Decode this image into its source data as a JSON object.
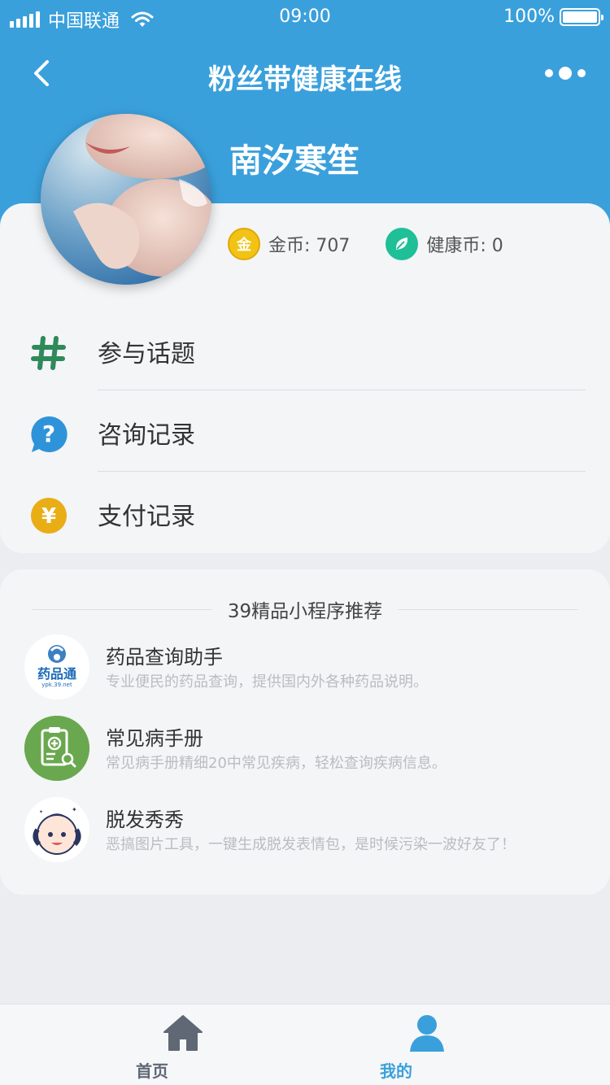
{
  "status_bar": {
    "carrier": "中国联通",
    "time": "09:00",
    "battery": "100%"
  },
  "nav": {
    "title": "粉丝带健康在线"
  },
  "profile": {
    "username": "南汐寒笙",
    "gold_coin_label": "金币: 707",
    "health_coin_label": "健康币: 0"
  },
  "menu": [
    {
      "label": "参与话题",
      "icon": "hash-icon"
    },
    {
      "label": "咨询记录",
      "icon": "question-bubble-icon"
    },
    {
      "label": "支付记录",
      "icon": "yuan-icon"
    }
  ],
  "recommend": {
    "title": "39精品小程序推荐",
    "apps": [
      {
        "name": "药品查询助手",
        "desc": "专业便民的药品查询，提供国内外各种药品说明。",
        "logo_text": "药品通",
        "logo_sub": "ypk.39.net"
      },
      {
        "name": "常见病手册",
        "desc": "常见病手册精细20中常见疾病，轻松查询疾病信息。"
      },
      {
        "name": "脱发秀秀",
        "desc": "恶搞图片工具，一键生成脱发表情包，是时候污染一波好友了！"
      }
    ]
  },
  "tabbar": {
    "home": "首页",
    "mine": "我的"
  },
  "colors": {
    "header": "#3aa0dc",
    "accent_active": "#3aa0dc",
    "inactive": "#5f6874"
  }
}
